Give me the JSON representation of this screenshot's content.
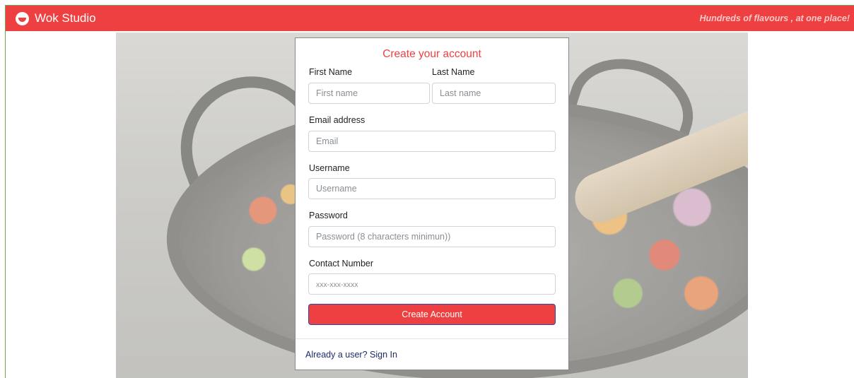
{
  "navbar": {
    "brand": "Wok Studio",
    "tagline": "Hundreds of flavours , at one place!",
    "color": "#ef4041"
  },
  "form": {
    "title": "Create your account",
    "first_name": {
      "label": "First Name",
      "placeholder": "First name",
      "value": ""
    },
    "last_name": {
      "label": "Last Name",
      "placeholder": "Last name",
      "value": ""
    },
    "email": {
      "label": "Email address",
      "placeholder": "Email",
      "value": ""
    },
    "username": {
      "label": "Username",
      "placeholder": "Username",
      "value": ""
    },
    "password": {
      "label": "Password",
      "placeholder": "Password (8 characters minimun))",
      "value": ""
    },
    "contact": {
      "label": "Contact Number",
      "placeholder": "xxx-xxx-xxxx",
      "value": ""
    },
    "submit_label": "Create Account",
    "signin_link": "Already a user? Sign In"
  },
  "icons": {
    "brand_logo": "wok-logo-icon"
  }
}
